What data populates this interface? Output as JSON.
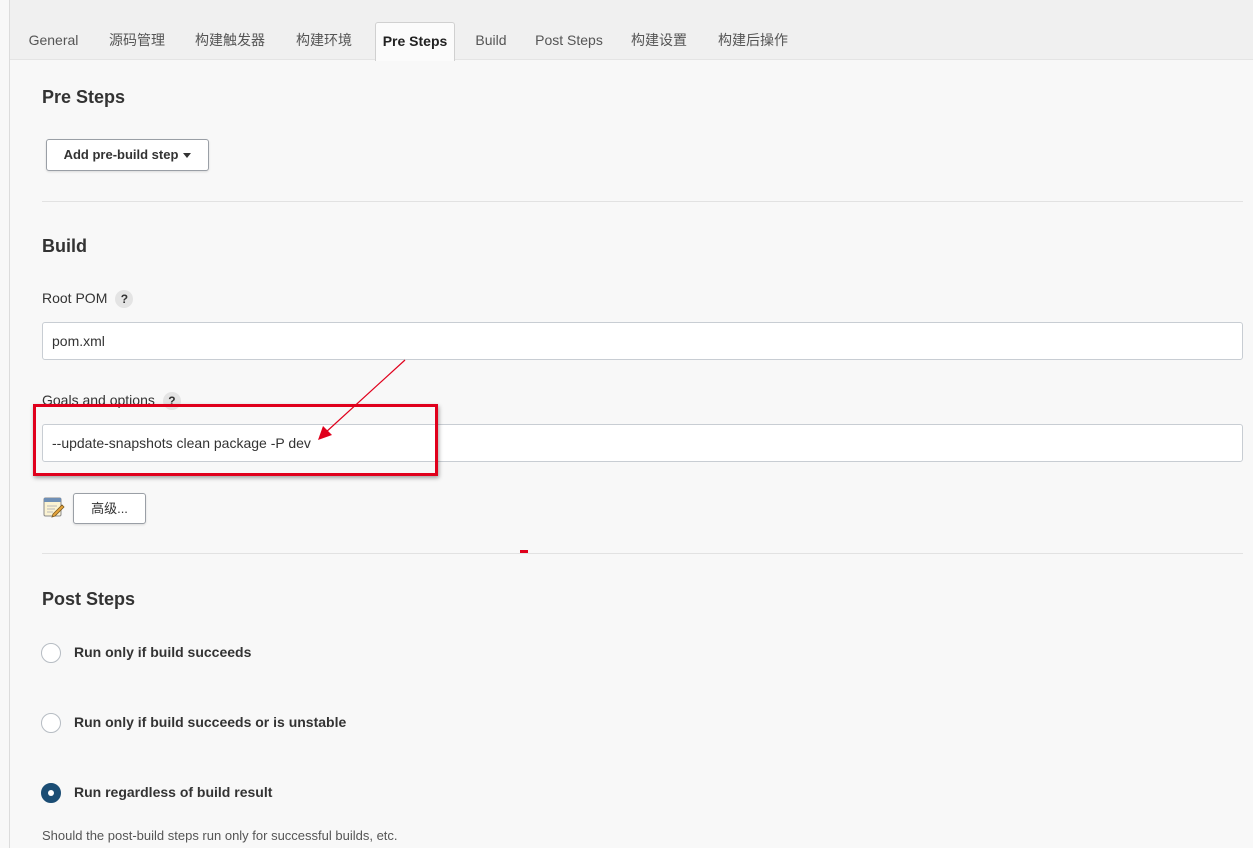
{
  "tabs": [
    {
      "label": "General"
    },
    {
      "label": "源码管理"
    },
    {
      "label": "构建触发器"
    },
    {
      "label": "构建环境"
    },
    {
      "label": "Pre Steps",
      "active": true
    },
    {
      "label": "Build"
    },
    {
      "label": "Post Steps"
    },
    {
      "label": "构建设置"
    },
    {
      "label": "构建后操作"
    }
  ],
  "pre_steps": {
    "title": "Pre Steps",
    "add_button": "Add pre-build step"
  },
  "build": {
    "title": "Build",
    "root_pom_label": "Root POM",
    "root_pom_value": "pom.xml",
    "goals_label": "Goals and options",
    "goals_value": "--update-snapshots clean package -P dev",
    "help_glyph": "?",
    "advanced_button": "高级..."
  },
  "post_steps": {
    "title": "Post Steps",
    "options": [
      {
        "label": "Run only if build succeeds",
        "checked": false
      },
      {
        "label": "Run only if build succeeds or is unstable",
        "checked": false
      },
      {
        "label": "Run regardless of build result",
        "checked": true
      }
    ],
    "hint": "Should the post-build steps run only for successful builds, etc."
  },
  "colors": {
    "annotation_red": "#e0001c",
    "radio_checked": "#1b4d74"
  },
  "icons": {
    "notepad": "notepad-pencil-icon",
    "dropdown": "caret-down-icon"
  }
}
